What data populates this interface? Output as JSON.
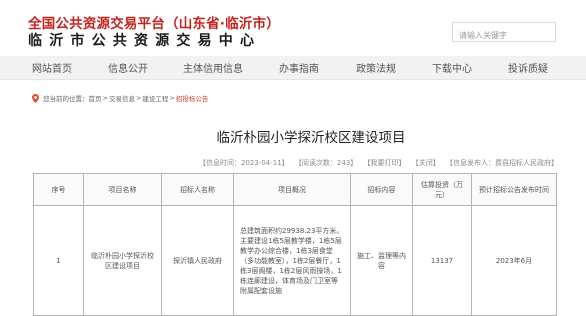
{
  "header": {
    "site_title": "全国公共资源交易平台（山东省·临沂市）",
    "center_name": "临沂市公共资源交易中心",
    "search_placeholder": "请输入关键字"
  },
  "nav": {
    "items": [
      "网站首页",
      "信息公开",
      "主体信用信息",
      "办事指南",
      "政策法规",
      "下载中心",
      "投诉质疑"
    ]
  },
  "breadcrumb": {
    "prefix": "您当前的位置：",
    "items": [
      "首页",
      "交易信息",
      "建设工程"
    ],
    "current": "招投标公告",
    "separator": ">"
  },
  "article": {
    "title": "临沂朴园小学探沂校区建设项目"
  },
  "meta": {
    "date": "【信息时间：2023-04-11】",
    "views": "【阅读次数：243】",
    "print": "【我要打印】",
    "close": "【关闭】",
    "publisher": "【信息发布人：费县招标人民政府】"
  },
  "table": {
    "headers": [
      "序号",
      "项目名称",
      "招标人名称",
      "项目概况",
      "招标内容",
      "估算投资（万元）",
      "预计招标公告发布时间"
    ],
    "rows": [
      {
        "index": "1",
        "name": "临沂朴园小学探沂校区建设项目",
        "tenderer": "探沂镇人民政府",
        "overview": "总建筑面积约29938.23平方米。主要建设1栋5层教学楼，1栋5层教学办公综合楼，1栋3层食堂（多功能教室），1栋2层餐厅，1栋3层阁楼，1栋2层风雨操场，1栋连廊建设，体育场及门卫室等附属配套设施",
        "content": "施工、监理等内容",
        "investment": "13137",
        "publish_time": "2023年6月"
      }
    ]
  },
  "colors": {
    "site_title": "#c7221c",
    "breadcrumb_current": "#d23a2a",
    "nav_bg": "#f2f2f2"
  }
}
